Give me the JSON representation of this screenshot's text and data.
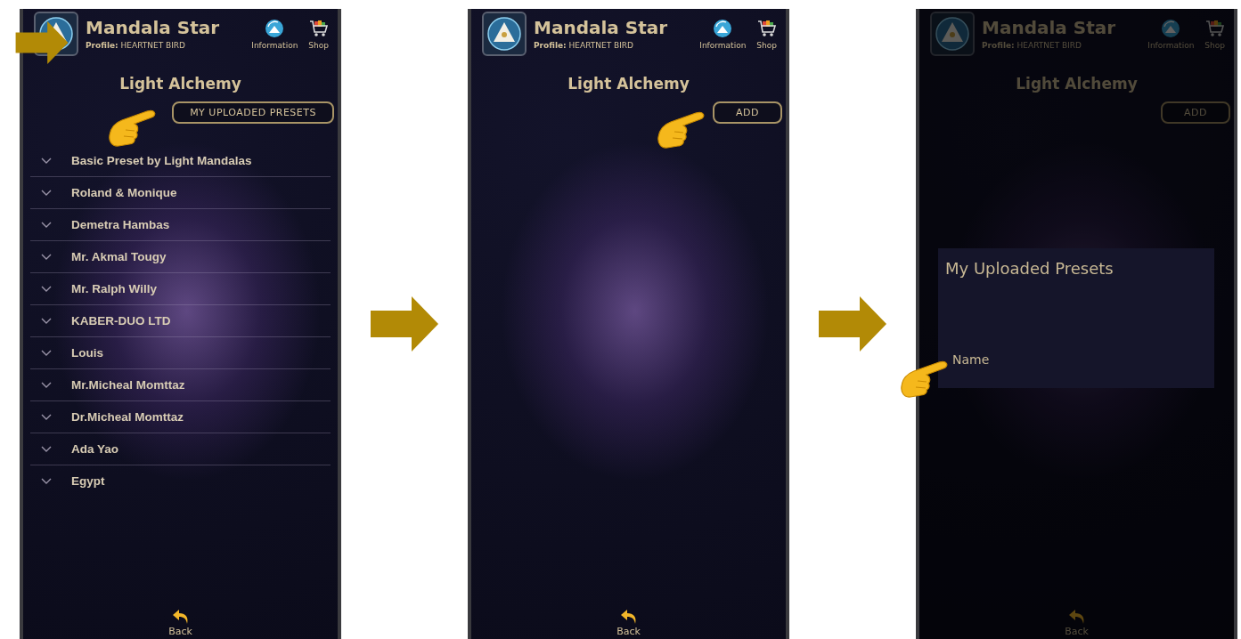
{
  "screens": [
    {
      "header": {
        "app_title": "Mandala Star",
        "profile": "**Profile:** HEARTNET BIRD",
        "nav": [
          {
            "kind": "info",
            "label": "Information"
          },
          {
            "kind": "shop",
            "label": "Shop"
          }
        ]
      },
      "page_title": "Light Alchemy",
      "action_button": "MY UPLOADED PRESETS",
      "pointer": {
        "kind": "button"
      },
      "dimmed": false,
      "presets": [
        "Basic Preset by Light Mandalas",
        "Roland & Monique",
        "Demetra Hambas",
        "Mr. Akmal Tougy",
        "Mr. Ralph Willy",
        "KABER-DUO LTD",
        "Louis",
        "Mr.Micheal Momttaz",
        "Dr.Micheal Momttaz",
        "Ada Yao",
        "Egypt"
      ],
      "back": "Back"
    },
    {
      "header": {
        "app_title": "Mandala Star",
        "profile": "**Profile:** HEARTNET BIRD",
        "nav": [
          {
            "kind": "info",
            "label": "Information"
          },
          {
            "kind": "shop",
            "label": "Shop"
          }
        ]
      },
      "page_title": "Light Alchemy",
      "action_button": "ADD",
      "pointer": {
        "kind": "button"
      },
      "dimmed": false,
      "back": "Back"
    },
    {
      "header": {
        "app_title": "Mandala Star",
        "profile": "**Profile:** HEARTNET BIRD",
        "nav": [
          {
            "kind": "info",
            "label": "Information"
          },
          {
            "kind": "shop",
            "label": "Shop"
          }
        ]
      },
      "page_title": "Light Alchemy",
      "action_button": "ADD",
      "pointer": {
        "kind": "field"
      },
      "dimmed": true,
      "dialog": {
        "title": "My Uploaded Presets",
        "name_field": {
          "placeholder": "Name"
        }
      },
      "back": "Back"
    }
  ]
}
